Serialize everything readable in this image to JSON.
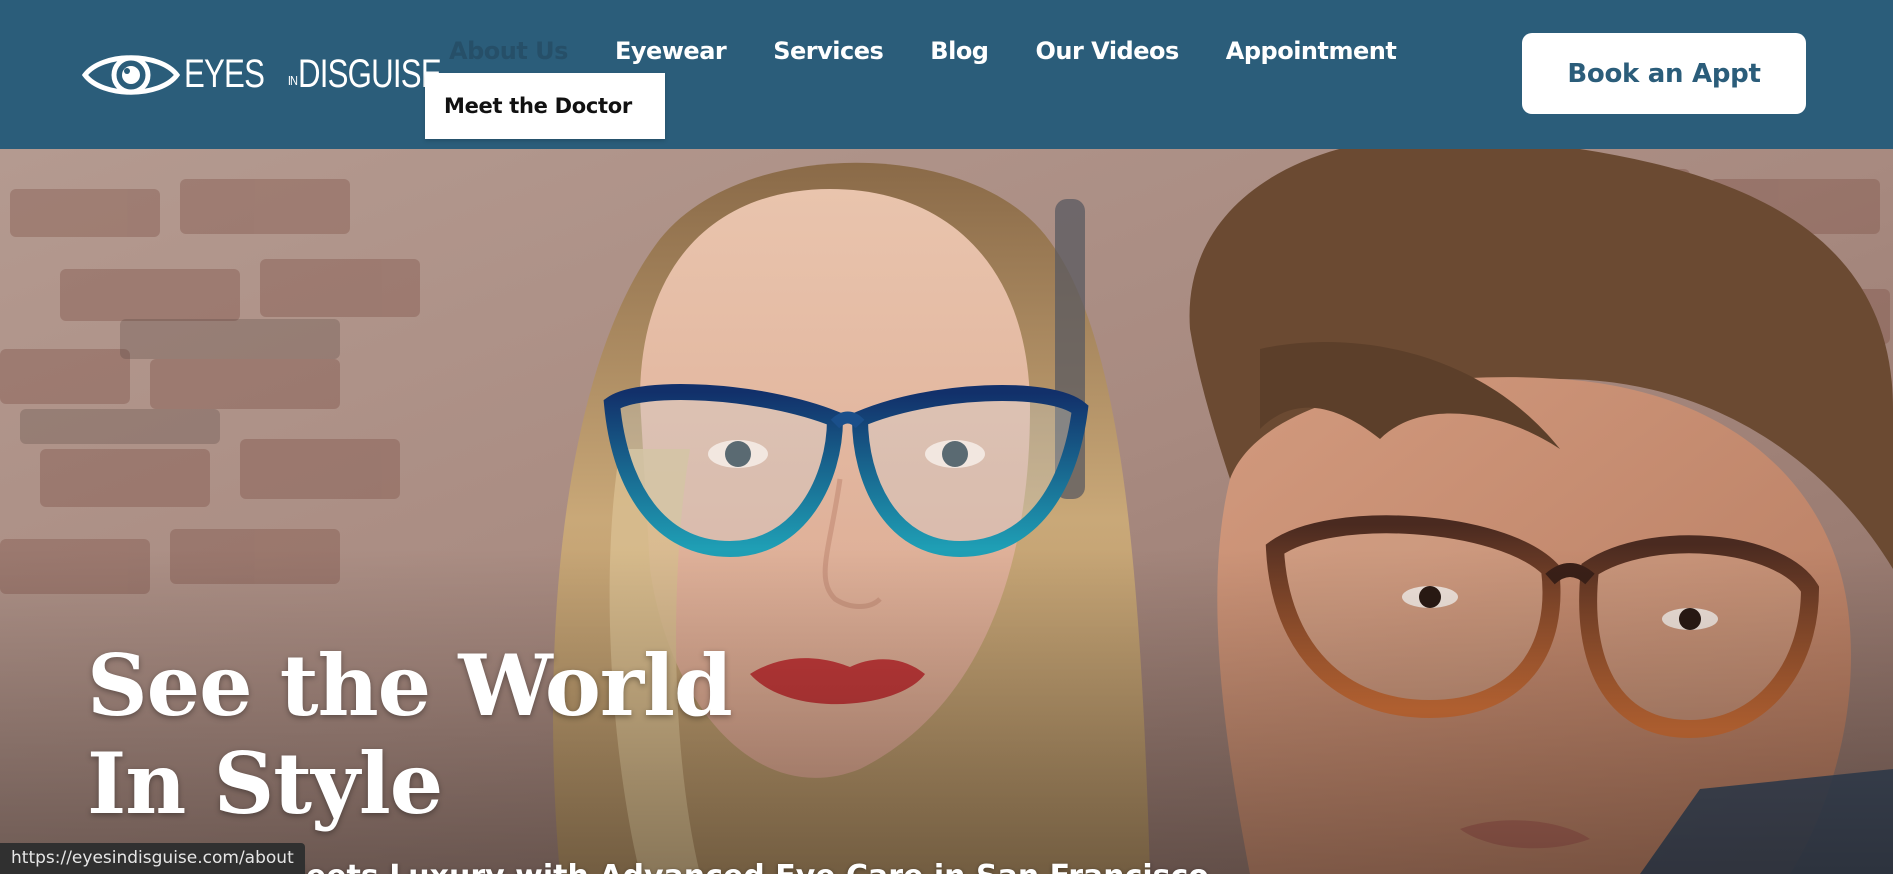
{
  "brand": {
    "logo_icon": "eye-icon",
    "name_part1": "EYES",
    "name_part2": "IN",
    "name_part3": "DISGUISE"
  },
  "nav": {
    "items": [
      {
        "label": "About Us",
        "state": "hovered"
      },
      {
        "label": "Eyewear"
      },
      {
        "label": "Services"
      },
      {
        "label": "Blog"
      },
      {
        "label": "Our Videos"
      },
      {
        "label": "Appointment"
      }
    ],
    "dropdown": {
      "items": [
        {
          "label": "Meet the Doctor"
        }
      ]
    }
  },
  "header": {
    "cta_label": "Book an Appt"
  },
  "hero": {
    "title_line1": "See the World",
    "title_line2": "In Style",
    "subtitle": "Meets Luxury with Advanced Eye Care in San Francisco"
  },
  "status_bar": {
    "url": "https://eyesindisguise.com/about"
  },
  "colors": {
    "header_bg": "#2b5d7a",
    "nav_active": "#264f68",
    "button_bg": "#ffffff",
    "button_text": "#2b5d7a"
  }
}
